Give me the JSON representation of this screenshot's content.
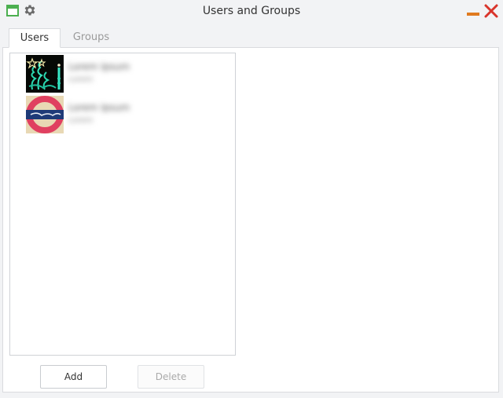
{
  "window": {
    "title": "Users and Groups",
    "accent_green": "#4caf50",
    "minimize_color": "#e07a1f",
    "close_color": "#d9342b"
  },
  "tabs": [
    {
      "label": "Users",
      "active": true
    },
    {
      "label": "Groups",
      "active": false
    }
  ],
  "users": [
    {
      "name": "Lorem Ipsum",
      "role": "Lorem",
      "avatar": "christmas-lights-avatar"
    },
    {
      "name": "Lorem Ipsum",
      "role": "Lorem",
      "avatar": "roundel-sign-avatar"
    }
  ],
  "buttons": {
    "add_label": "Add",
    "delete_label": "Delete",
    "delete_enabled": false
  }
}
